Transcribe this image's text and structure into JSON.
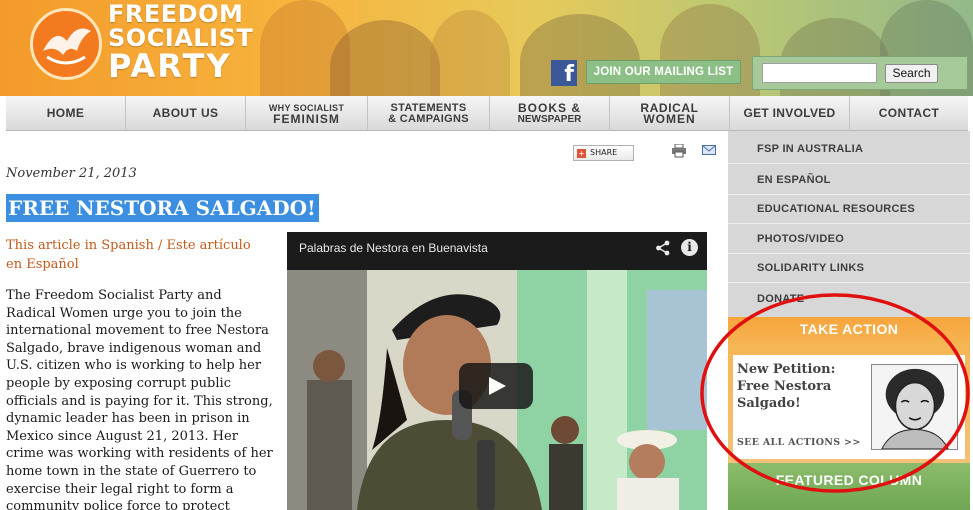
{
  "brand": {
    "line1": "FREEDOM",
    "line2": "SOCIALIST",
    "line3": "PARTY"
  },
  "header": {
    "facebook_icon": "facebook-icon",
    "mailing_list_label": "JOIN OUR MAILING LIST",
    "search_placeholder": "",
    "search_button_label": "Search"
  },
  "nav": [
    {
      "top": "",
      "bot": "HOME"
    },
    {
      "top": "",
      "bot": "ABOUT US"
    },
    {
      "top": "WHY SOCIALIST",
      "bot": "FEMINISM"
    },
    {
      "top": "STATEMENTS",
      "bot": "& CAMPAIGNS"
    },
    {
      "top": "BOOKS &",
      "bot": "NEWSPAPER"
    },
    {
      "top": "RADICAL",
      "bot": "WOMEN"
    },
    {
      "top": "",
      "bot": "GET INVOLVED"
    },
    {
      "top": "",
      "bot": "CONTACT"
    }
  ],
  "article": {
    "date": "November 21, 2013",
    "share_label": "SHARE",
    "headline": "FREE NESTORA SALGADO!",
    "spanish_link": "This article in Spanish / Este artículo en Español",
    "body": "The Freedom Socialist Party and Radical Women urge you to join the international movement to free Nestora Salgado, brave indigenous woman and U.S. citizen who is working to help her people by exposing corrupt public officials and is paying for it. This strong, dynamic leader has been in prison in Mexico since August 21, 2013. Her crime was working with residents of her home town in the state of Guerrero to exercise their legal right to form a community police force to protect themselves from violent drug traffickers"
  },
  "video": {
    "title": "Palabras de Nestora en Buenavista"
  },
  "sidebar": {
    "items": [
      {
        "label": "FSP IN AUSTRALIA"
      },
      {
        "label": "EN ESPAÑOL"
      },
      {
        "label": "EDUCATIONAL RESOURCES"
      },
      {
        "label": "PHOTOS/VIDEO"
      },
      {
        "label": "SOLIDARITY LINKS"
      },
      {
        "label": "DONATE"
      }
    ],
    "take_action": {
      "title": "TAKE ACTION",
      "petition_title": "New Petition: Free Nestora Salgado!",
      "see_all": "SEE ALL ACTIONS >>"
    },
    "featured_title": "FEATURED COLUMN"
  },
  "colors": {
    "accent_orange": "#f47a20",
    "highlight_blue": "#3c8fe0",
    "link_orange": "#c25a1b",
    "annotation_red": "#e01010"
  }
}
